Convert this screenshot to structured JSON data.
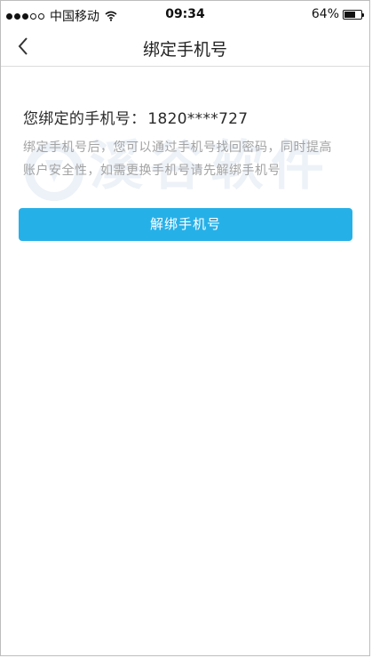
{
  "status_bar": {
    "carrier": "中国移动",
    "time": "09:34",
    "battery_text": "64%",
    "battery_level": 0.64,
    "signal_bars_filled": 3,
    "signal_bars_total": 5,
    "wifi_icon": "wifi-icon"
  },
  "nav": {
    "title": "绑定手机号",
    "back_icon": "chevron-left-icon"
  },
  "bound": {
    "label": "您绑定的手机号：",
    "phone": "1820****727"
  },
  "description": "绑定手机号后，您可以通过手机号找回密码，同时提高账户安全性，如需更换手机号请先解绑手机号",
  "watermark": {
    "text": "溪谷软件"
  },
  "actions": {
    "unbind_label": "解绑手机号"
  },
  "colors": {
    "accent": "#26b0e8",
    "description_text": "#a3a3a3",
    "title_text": "#222222"
  }
}
